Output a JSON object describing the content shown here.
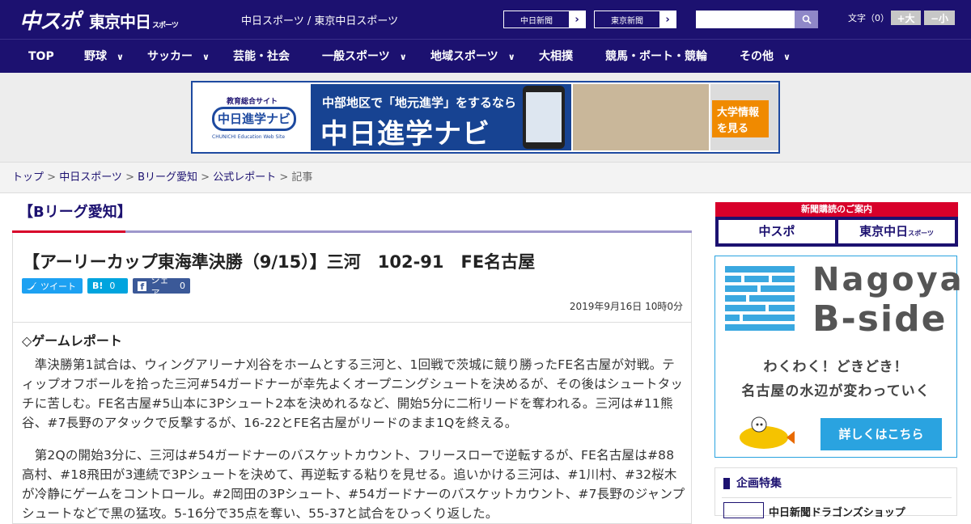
{
  "header": {
    "logo_chuspo": "中スポ",
    "logo_tokyo": "東京中日",
    "logo_tokyo_sub": "スポーツ",
    "site_title": "中日スポーツ / 東京中日スポーツ",
    "paper_links": [
      "中日新聞",
      "東京新聞"
    ],
    "font_size_label": "文字（0）",
    "font_bigger": "+大",
    "font_smaller": "−小"
  },
  "nav": {
    "items": [
      {
        "label": "TOP",
        "dropdown": false
      },
      {
        "label": "野球",
        "dropdown": true
      },
      {
        "label": "サッカー",
        "dropdown": true
      },
      {
        "label": "芸能・社会",
        "dropdown": false
      },
      {
        "label": "一般スポーツ",
        "dropdown": true
      },
      {
        "label": "地域スポーツ",
        "dropdown": true
      },
      {
        "label": "大相撲",
        "dropdown": false
      },
      {
        "label": "競馬・ボート・競輪",
        "dropdown": false
      },
      {
        "label": "その他",
        "dropdown": true
      }
    ]
  },
  "ad_banner": {
    "logo_small": "教育総合サイト",
    "logo_main": "中日進学ナビ",
    "logo_en": "CHUNICHI Education Web Site",
    "tagline": "中部地区で「地元進学」をするなら",
    "title": "中日進学ナビ",
    "cta": "大学情報を見る"
  },
  "breadcrumb": {
    "items": [
      "トップ",
      "中日スポーツ",
      "Bリーグ愛知",
      "公式レポート"
    ],
    "current": "記事",
    "sep": " > "
  },
  "category": "【Bリーグ愛知】",
  "article": {
    "headline": "【アーリーカップ東海準決勝（9/15）】三河　102-91　FE名古屋",
    "share": {
      "tweet": "ツイート",
      "hatena_label": "B!",
      "hatena_count": "0",
      "fb_label": "シェア",
      "fb_count": "0"
    },
    "date": "2019年9月16日 10時0分",
    "section_title": "◇ゲームレポート",
    "paragraphs": [
      "　準決勝第1試合は、ウィングアリーナ刈谷をホームとする三河と、1回戦で茨城に競り勝ったFE名古屋が対戦。ティップオフボールを拾った三河#54ガードナーが幸先よくオープニングシュートを決めるが、その後はシュートタッチに苦しむ。FE名古屋#5山本に3Pシュート2本を決めれるなど、開始5分に二桁リードを奪われる。三河は#11熊谷、#7長野のアタックで反撃するが、16-22とFE名古屋がリードのまま1Qを終える。",
      "　第2Qの開始3分に、三河は#54ガードナーのバスケットカウント、フリースローで逆転するが、FE名古屋は#88高村、#18飛田が3連続で3Pシュートを決めて、再逆転する粘りを見せる。追いかける三河は、#1川村、#32桜木が冷静にゲームをコントロール。#2岡田の3Pシュート、#54ガードナーのバスケットカウント、#7長野のジャンプシュートなどで黒の猛攻。5-16分で35点を奪い、55-37と試合をひっくり返した。"
    ]
  },
  "sidebar": {
    "subscribe_header": "新聞購読のご案内",
    "subscribe_a": "中スポ",
    "subscribe_b": "東京中日",
    "subscribe_b_sub": "スポーツ",
    "bside_title1": "Nagoya",
    "bside_title2": "B-side",
    "bside_copy1": "わくわく！どきどき！",
    "bside_copy2": "名古屋の水辺が変わっていく",
    "bside_cta": "詳しくはこちら",
    "feature_header": "企画特集",
    "feature_item": "中日新聞ドラゴンズショップ"
  },
  "colors": {
    "brand": "#1c1170",
    "accent_red": "#d8002a",
    "twitter": "#1da1f2",
    "hatena": "#00a4de",
    "facebook": "#3b5998",
    "bside_blue": "#2aa3e0"
  }
}
